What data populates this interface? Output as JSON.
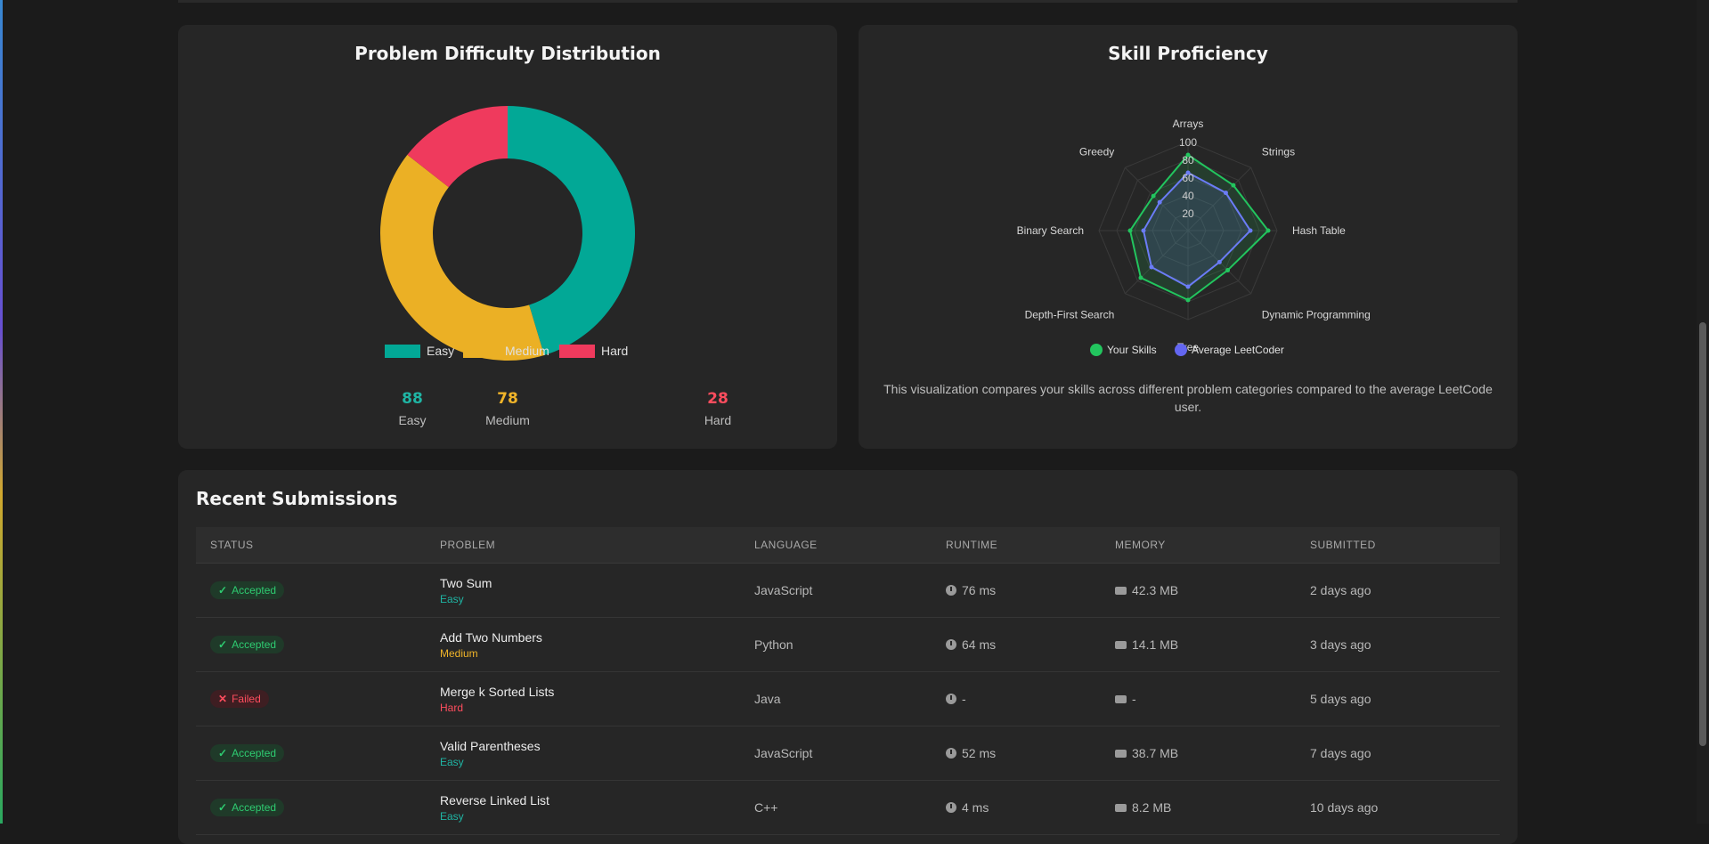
{
  "difficulty_card": {
    "title": "Problem Difficulty Distribution",
    "legend": [
      {
        "label": "Easy",
        "color": "#02a896"
      },
      {
        "label": "Medium",
        "color": "#ebb025"
      },
      {
        "label": "Hard",
        "color": "#ef3a5d"
      }
    ],
    "stats": [
      {
        "value": "88",
        "label": "Easy",
        "color": "#1fb5a4"
      },
      {
        "value": "78",
        "label": "Medium",
        "color": "#f0b429"
      },
      {
        "value": "28",
        "label": "Hard",
        "color": "#ff4d5e"
      }
    ]
  },
  "skills_card": {
    "title": "Skill Proficiency",
    "legend": [
      {
        "label": "Your Skills",
        "color": "#22c55e"
      },
      {
        "label": "Average LeetCoder",
        "color": "#6366f1"
      }
    ],
    "caption": "This visualization compares your skills across different problem categories compared to the average LeetCode user."
  },
  "chart_data": [
    {
      "type": "pie",
      "title": "Problem Difficulty Distribution",
      "categories": [
        "Easy",
        "Medium",
        "Hard"
      ],
      "values": [
        88,
        78,
        28
      ],
      "colors": [
        "#02a896",
        "#ebb025",
        "#ef3a5d"
      ],
      "donut": true,
      "legend": "bottom"
    },
    {
      "type": "radar",
      "title": "Skill Proficiency",
      "categories": [
        "Arrays",
        "Strings",
        "Hash Table",
        "Dynamic Programming",
        "Tree",
        "Depth-First Search",
        "Binary Search",
        "Greedy"
      ],
      "ticks": [
        "20",
        "40",
        "60",
        "80",
        "100"
      ],
      "range": [
        0,
        100
      ],
      "series": [
        {
          "name": "Your Skills",
          "values": [
            85,
            72,
            90,
            63,
            78,
            75,
            65,
            55
          ],
          "color": "#22c55e"
        },
        {
          "name": "Average LeetCoder",
          "values": [
            65,
            60,
            70,
            50,
            63,
            58,
            50,
            45
          ],
          "color": "#6b7cf6"
        }
      ],
      "legend": "bottom"
    }
  ],
  "submissions": {
    "title": "Recent Submissions",
    "columns": [
      "STATUS",
      "PROBLEM",
      "LANGUAGE",
      "RUNTIME",
      "MEMORY",
      "SUBMITTED"
    ],
    "rows": [
      {
        "status": "Accepted",
        "ok": true,
        "problem": "Two Sum",
        "difficulty": "Easy",
        "language": "JavaScript",
        "runtime": "76 ms",
        "memory": "42.3 MB",
        "submitted": "2 days ago"
      },
      {
        "status": "Accepted",
        "ok": true,
        "problem": "Add Two Numbers",
        "difficulty": "Medium",
        "language": "Python",
        "runtime": "64 ms",
        "memory": "14.1 MB",
        "submitted": "3 days ago"
      },
      {
        "status": "Failed",
        "ok": false,
        "problem": "Merge k Sorted Lists",
        "difficulty": "Hard",
        "language": "Java",
        "runtime": "-",
        "memory": "-",
        "submitted": "5 days ago"
      },
      {
        "status": "Accepted",
        "ok": true,
        "problem": "Valid Parentheses",
        "difficulty": "Easy",
        "language": "JavaScript",
        "runtime": "52 ms",
        "memory": "38.7 MB",
        "submitted": "7 days ago"
      },
      {
        "status": "Accepted",
        "ok": true,
        "problem": "Reverse Linked List",
        "difficulty": "Easy",
        "language": "C++",
        "runtime": "4 ms",
        "memory": "8.2 MB",
        "submitted": "10 days ago"
      }
    ],
    "difficulty_colors": {
      "Easy": "#1fb5a4",
      "Medium": "#f0b429",
      "Hard": "#ff4d5e"
    }
  }
}
